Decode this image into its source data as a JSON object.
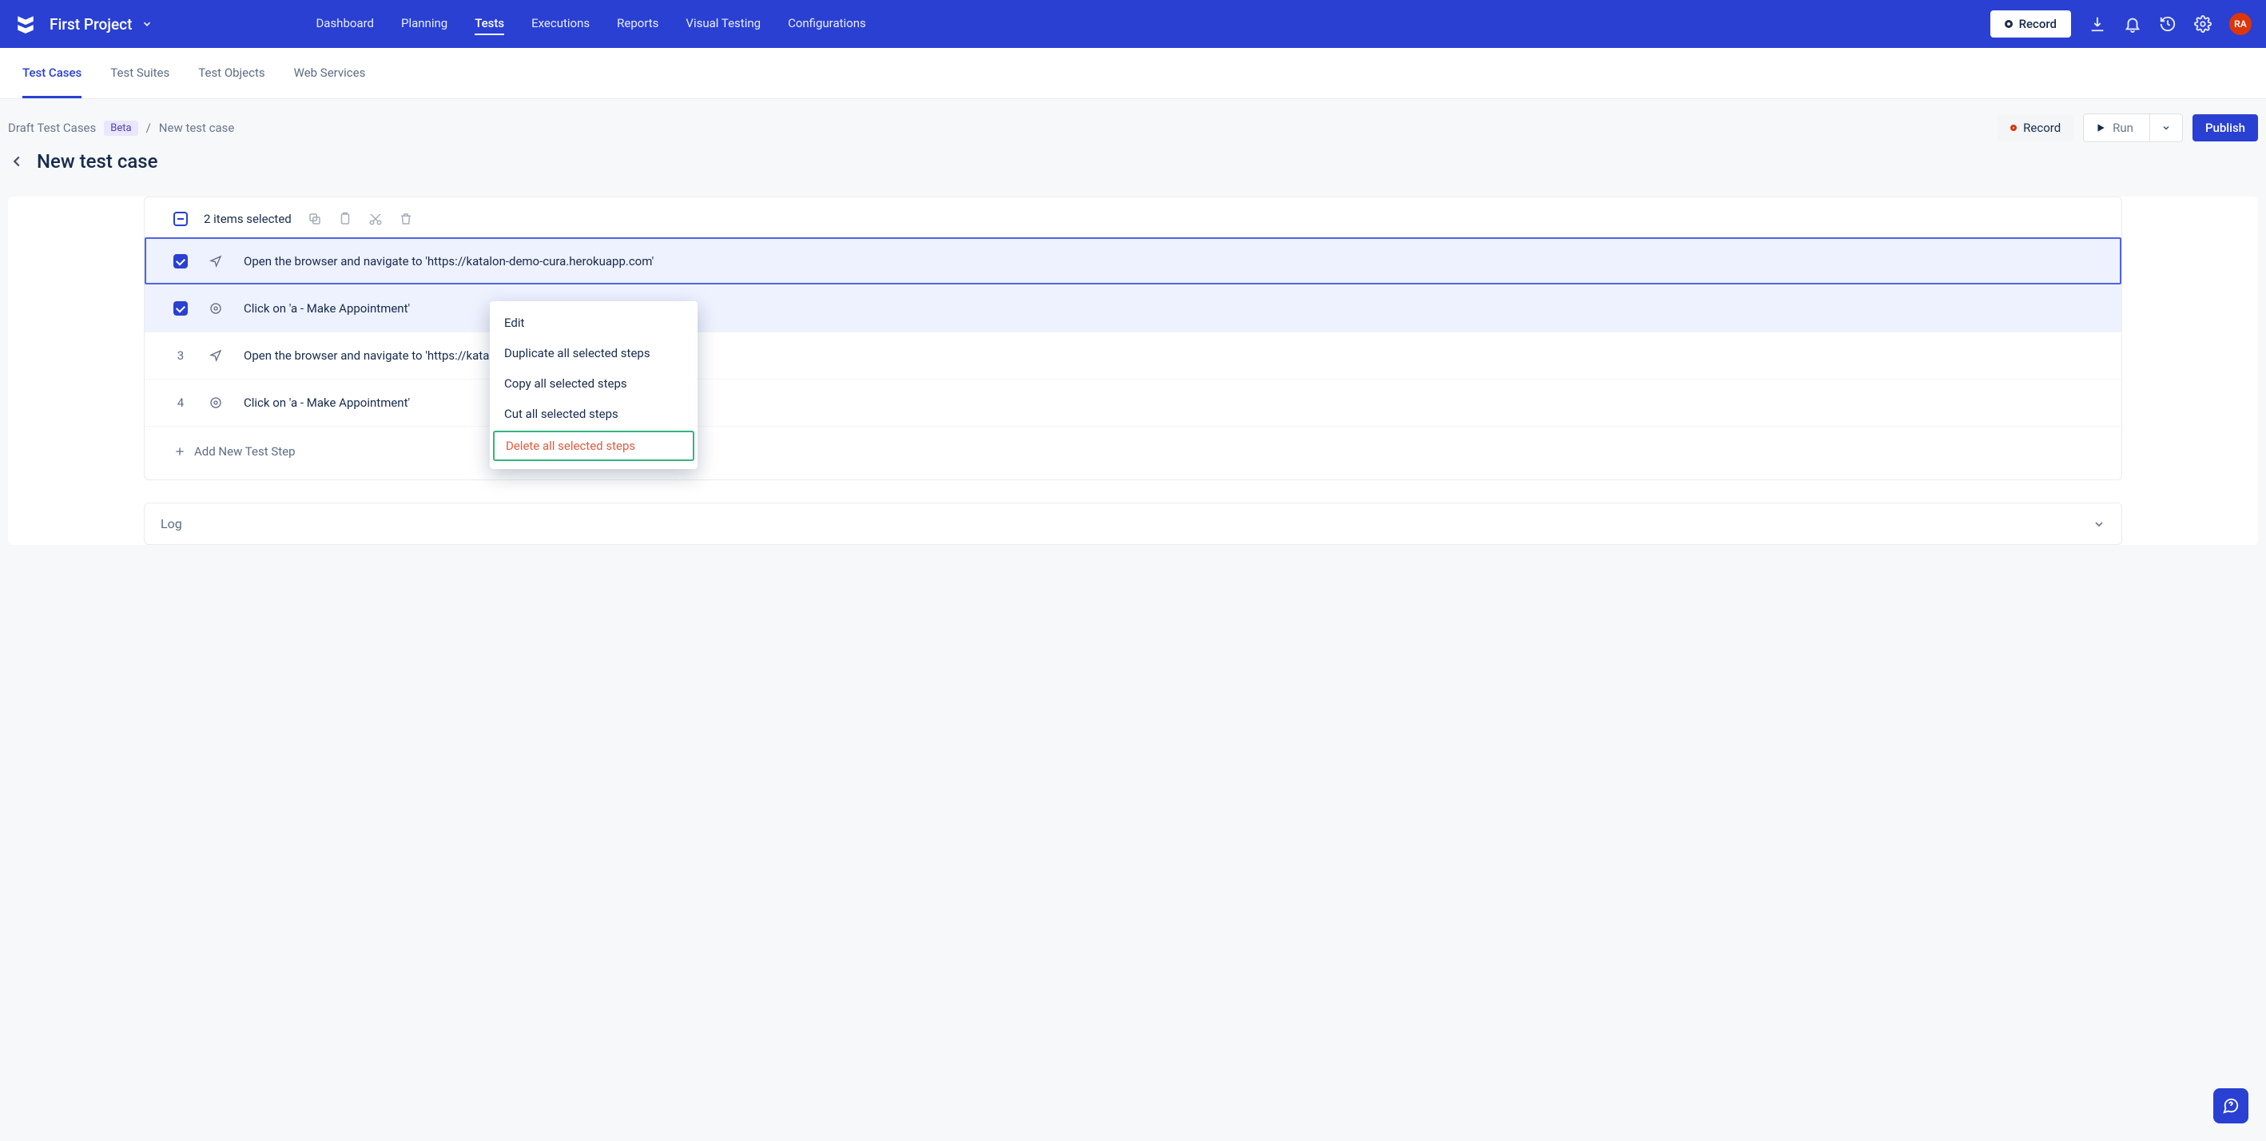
{
  "header": {
    "project_name": "First Project",
    "nav": [
      "Dashboard",
      "Planning",
      "Tests",
      "Executions",
      "Reports",
      "Visual Testing",
      "Configurations"
    ],
    "active_nav": "Tests",
    "record_label": "Record",
    "avatar_initials": "RA"
  },
  "sub_tabs": {
    "items": [
      "Test Cases",
      "Test Suites",
      "Test Objects",
      "Web Services"
    ],
    "active": "Test Cases"
  },
  "breadcrumb": {
    "root": "Draft Test Cases",
    "badge": "Beta",
    "current": "New test case"
  },
  "page_title": "New test case",
  "actions": {
    "record": "Record",
    "run": "Run",
    "publish": "Publish"
  },
  "selection": {
    "summary": "2 items selected"
  },
  "steps": [
    {
      "num": "",
      "checked": true,
      "icon": "navigate",
      "text": "Open the browser and navigate to 'https://katalon-demo-cura.herokuapp.com'"
    },
    {
      "num": "",
      "checked": true,
      "icon": "click",
      "text": "Click on 'a - Make Appointment'"
    },
    {
      "num": "3",
      "checked": false,
      "icon": "navigate",
      "text": "Open the browser and navigate to 'https://katalon-demo-cura.herokuapp.com'"
    },
    {
      "num": "4",
      "checked": false,
      "icon": "click",
      "text": "Click on 'a - Make Appointment'"
    }
  ],
  "context_menu": {
    "items": [
      {
        "label": "Edit",
        "danger": false
      },
      {
        "label": "Duplicate all selected steps",
        "danger": false
      },
      {
        "label": "Copy all selected steps",
        "danger": false
      },
      {
        "label": "Cut all selected steps",
        "danger": false
      },
      {
        "label": "Delete all selected steps",
        "danger": true
      }
    ]
  },
  "add_step_label": "Add New Test Step",
  "log_label": "Log"
}
